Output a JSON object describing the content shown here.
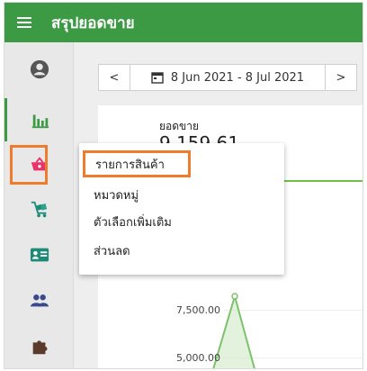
{
  "app": {
    "title": "สรุปยอดขาย"
  },
  "sidebar": {
    "items": [
      {
        "name": "profile-icon"
      },
      {
        "name": "report-chart-icon"
      },
      {
        "name": "basket-icon"
      },
      {
        "name": "cart-delivery-icon"
      },
      {
        "name": "id-card-icon"
      },
      {
        "name": "users-icon"
      },
      {
        "name": "puzzle-icon"
      }
    ],
    "active_index": 1,
    "highlighted_index": 2,
    "colors": {
      "active": "#3d9a44",
      "basket": "#e8336b",
      "highlight": "#f07b2a",
      "icon": "#555555",
      "teal": "#1f8a78"
    }
  },
  "datebar": {
    "prev": "<",
    "range": "8 Jun 2021 - 8 Jul 2021",
    "next": ">"
  },
  "card": {
    "label": "ยอดขาย",
    "value": "9,159.61"
  },
  "dropdown": {
    "items": [
      {
        "label": "รายการสินค้า"
      },
      {
        "label": "หมวดหมู่"
      },
      {
        "label": "ตัวเลือกเพิ่มเติม"
      },
      {
        "label": "ส่วนลด"
      }
    ]
  },
  "chart_data": {
    "type": "area",
    "y_ticks": [
      "7,500.00",
      "5,000.00"
    ],
    "color": "#7cc26b"
  }
}
